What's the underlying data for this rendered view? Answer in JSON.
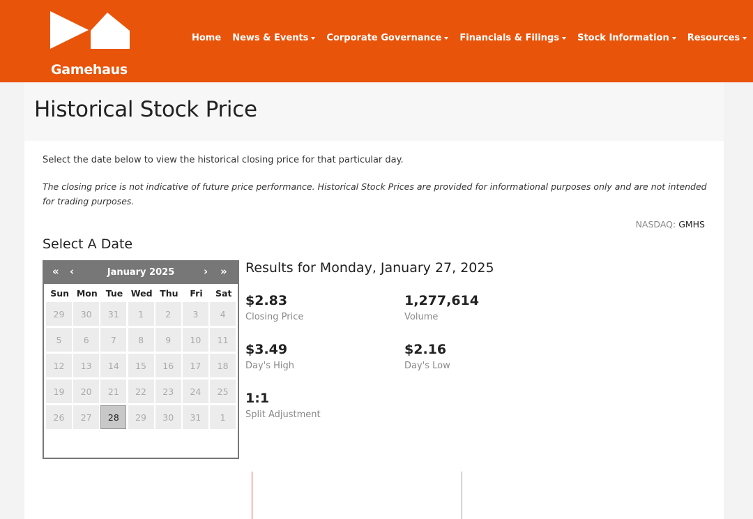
{
  "header": {
    "logo_text": "Gamehaus",
    "brand_color": "#e8540a",
    "nav": [
      {
        "label": "Home",
        "dropdown": false
      },
      {
        "label": "News & Events",
        "dropdown": true
      },
      {
        "label": "Corporate Governance",
        "dropdown": true
      },
      {
        "label": "Financials & Filings",
        "dropdown": true
      },
      {
        "label": "Stock Information",
        "dropdown": true
      },
      {
        "label": "Resources",
        "dropdown": true
      }
    ]
  },
  "page": {
    "title": "Historical Stock Price",
    "intro": "Select the date below to view the historical closing price for that particular day.",
    "disclaimer": "The closing price is not indicative of future price performance.  Historical Stock Prices are provided for informational purposes only and are not intended for trading purposes.",
    "exchange": "NASDAQ:",
    "symbol": "GMHS",
    "select_heading": "Select A Date"
  },
  "calendar": {
    "month_label": "January 2025",
    "nav_icons": [
      "double-chevron-left-icon",
      "chevron-left-icon",
      "chevron-right-icon",
      "double-chevron-right-icon"
    ],
    "weekdays": [
      "Sun",
      "Mon",
      "Tue",
      "Wed",
      "Thu",
      "Fri",
      "Sat"
    ],
    "weeks": [
      [
        "29",
        "30",
        "31",
        "1",
        "2",
        "3",
        "4"
      ],
      [
        "5",
        "6",
        "7",
        "8",
        "9",
        "10",
        "11"
      ],
      [
        "12",
        "13",
        "14",
        "15",
        "16",
        "17",
        "18"
      ],
      [
        "19",
        "20",
        "21",
        "22",
        "23",
        "24",
        "25"
      ],
      [
        "26",
        "27",
        "28",
        "29",
        "30",
        "31",
        "1"
      ]
    ],
    "selected": "28"
  },
  "results": {
    "heading": "Results for Monday, January 27, 2025",
    "closing_price": {
      "value": "$2.83",
      "label": "Closing Price"
    },
    "volume": {
      "value": "1,277,614",
      "label": "Volume"
    },
    "days_high": {
      "value": "$3.49",
      "label": "Day's High"
    },
    "days_low": {
      "value": "$2.16",
      "label": "Day's Low"
    },
    "split": {
      "value": "1:1",
      "label": "Split Adjustment"
    }
  }
}
